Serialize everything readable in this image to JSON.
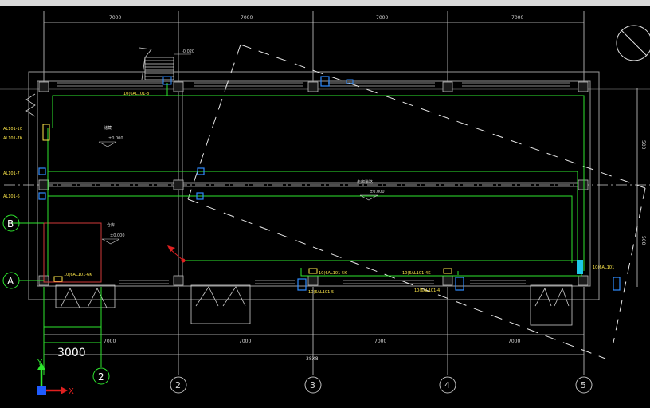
{
  "window": {
    "title_bar": ""
  },
  "dimensions": {
    "top": [
      "7000",
      "7000",
      "7000",
      "7000"
    ],
    "bottom": [
      "7000",
      "7000",
      "7000",
      "7000"
    ],
    "overall": "38X8",
    "right_1": "500",
    "right_2": "500",
    "scale_label": "3000"
  },
  "grid": {
    "columns": [
      "2",
      "2",
      "3",
      "4",
      "5"
    ],
    "rows": [
      "B",
      "A"
    ]
  },
  "rooms": {
    "r1_name": "储藏",
    "r1_level": "±0.000",
    "r2_name": "走廊道路",
    "r2_level": "±0.000",
    "r3_name": "仓库",
    "r3_level": "±0.000"
  },
  "stair_note": "-0.020",
  "tags": {
    "t1": "10(6AL101-8",
    "t2": "AL101-10",
    "t3": "AL101-7K",
    "t4": "AL101-7",
    "t5": "AL101-6",
    "t6": "10(6AL101-6K",
    "t7": "10(6AL101-5K",
    "t8": "10(6AL101-5",
    "t9": "10(6AL101-4K",
    "t10": "10(6AL101-4",
    "t11": "10(6AL101"
  },
  "ucs": {
    "x": "X",
    "y": "Y"
  },
  "colors": {
    "wire": "#2ee62e",
    "tag": "#ffe94a",
    "device": "#2f8cff",
    "grid": "#cfcfcf",
    "wall": "#9a9a9a"
  }
}
